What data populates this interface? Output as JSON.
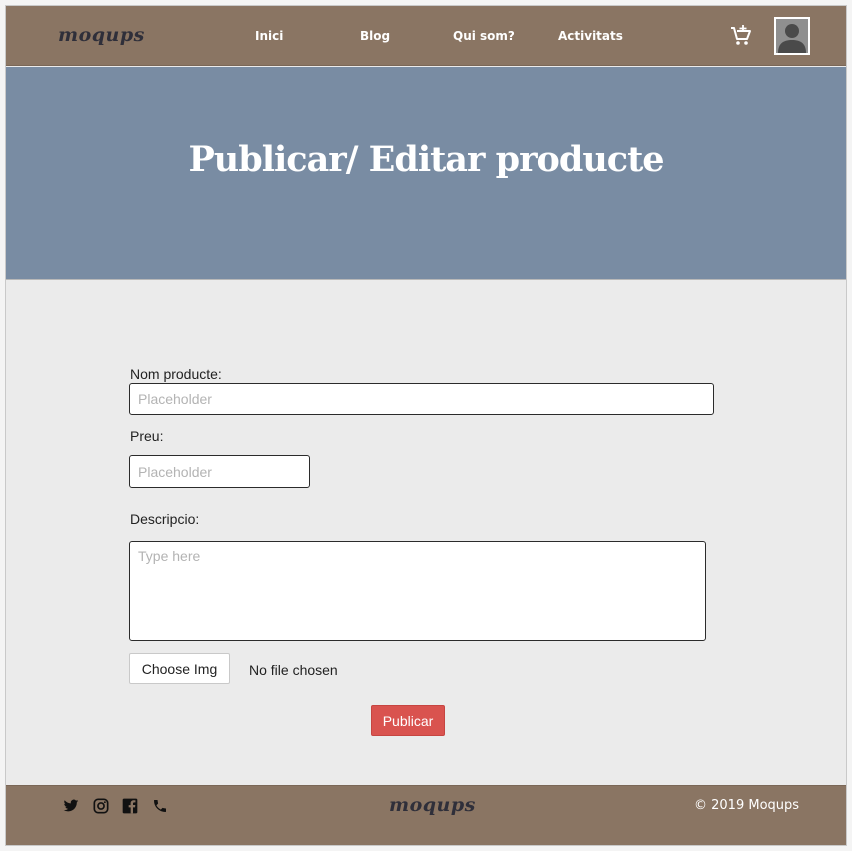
{
  "header": {
    "logo": "moqups",
    "nav": [
      "Inici",
      "Blog",
      "Qui som?",
      "Activitats"
    ],
    "cart_icon": "cart-plus-icon",
    "avatar_icon": "user-avatar-icon"
  },
  "hero": {
    "title": "Publicar/ Editar producte",
    "background": "#798ca3"
  },
  "form": {
    "name_label": "Nom producte:",
    "name_placeholder": "Placeholder",
    "price_label": "Preu:",
    "price_placeholder": "Placeholder",
    "description_label": "Descripcio:",
    "description_placeholder": "Type here",
    "choose_button": "Choose Img",
    "file_status": "No file chosen",
    "submit_button": "Publicar"
  },
  "footer": {
    "social_icons": [
      "twitter-icon",
      "instagram-icon",
      "facebook-icon",
      "phone-icon"
    ],
    "logo": "moqups",
    "copyright": "© 2019  Moqups"
  },
  "colors": {
    "bar": "#8a7563",
    "hero": "#798ca3",
    "page": "#ebebeb",
    "primary_button": "#d9534f"
  }
}
